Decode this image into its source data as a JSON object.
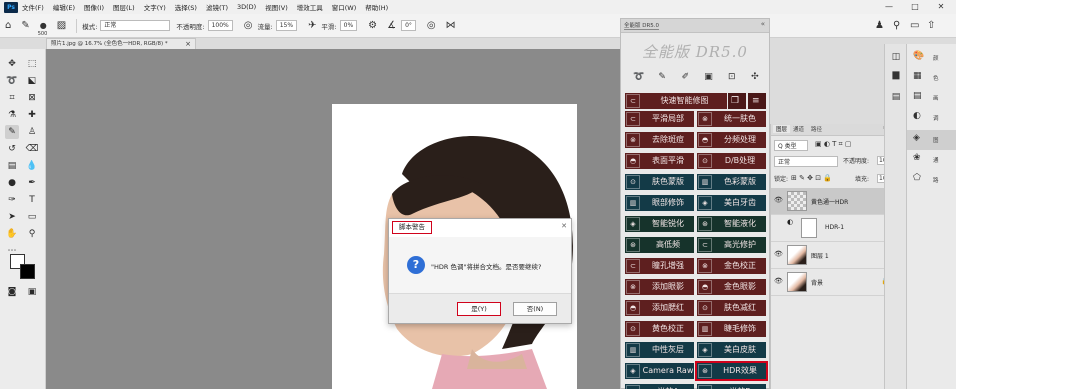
{
  "menubar": {
    "items": [
      "文件(F)",
      "编辑(E)",
      "图像(I)",
      "图层(L)",
      "文字(Y)",
      "选择(S)",
      "滤镜(T)",
      "3D(D)",
      "视图(V)",
      "增效工具",
      "窗口(W)",
      "帮助(H)"
    ],
    "minimize": "—",
    "maximize": "□",
    "close": "✕"
  },
  "optbar": {
    "brush_size": "500",
    "mode_label": "模式:",
    "mode_value": "正常",
    "opacity_label": "不透明度:",
    "opacity_value": "100%",
    "flow_label": "流量:",
    "flow_value": "15%",
    "smooth_label": "平滑:",
    "smooth_value": "0%",
    "angle_value": "0°"
  },
  "document": {
    "tab_title": "照片1.jpg @ 16.7% (全色色一HDR, RGB/8) *",
    "close": "×"
  },
  "dialog": {
    "title": "脚本警告",
    "message": "\"HDR 色调\"将拼合文档。是否要继续?",
    "yes": "是(Y)",
    "no": "否(N)",
    "icon": "?"
  },
  "plugin": {
    "header_label": "全能版 DR5.0",
    "collapse": "«",
    "menu": "≡",
    "brand": "全能版 DR5.0",
    "icon_names": [
      "lasso-icon",
      "brush-icon",
      "eraser-icon",
      "layer-icon",
      "crop-icon",
      "shortcut-icon"
    ],
    "top_button": "快速智能修图",
    "buttons": [
      {
        "left": "平滑局部",
        "right": "统一肤色",
        "color": "red"
      },
      {
        "left": "去除斑痘",
        "right": "分频处理",
        "color": "red"
      },
      {
        "left": "表面平滑",
        "right": "D/B处理",
        "color": "red"
      },
      {
        "left": "肤色蒙版",
        "right": "色彩蒙版",
        "color": "blue"
      },
      {
        "left": "眼部修饰",
        "right": "美白牙齿",
        "color": "blue"
      },
      {
        "left": "智能锐化",
        "right": "智能液化",
        "color": "green"
      },
      {
        "left": "高低频",
        "right": "高光修护",
        "color": "green"
      },
      {
        "left": "瞳孔增强",
        "right": "金色校正",
        "color": "red"
      },
      {
        "left": "添加眼影",
        "right": "金色眼影",
        "color": "red"
      },
      {
        "left": "添加腮红",
        "right": "肤色减红",
        "color": "red"
      },
      {
        "left": "黄色校正",
        "right": "睫毛修饰",
        "color": "red"
      },
      {
        "left": "中性灰层",
        "right": "美白皮肤",
        "color": "blue"
      },
      {
        "left": "Camera Raw",
        "right": "HDR效果",
        "color": "blue"
      },
      {
        "left": "光效A",
        "right": "光效B",
        "color": "blue"
      }
    ]
  },
  "layers": {
    "tabs": [
      "图层",
      "通道",
      "路径"
    ],
    "kind_label": "Q 类型",
    "blend_mode": "正常",
    "opacity_label": "不透明度:",
    "opacity_value": "100%",
    "lock_label": "锁定:",
    "fill_label": "填充:",
    "fill_value": "100%",
    "items": [
      {
        "name": "黄色通一HDR",
        "selected": true
      },
      {
        "name": "HDR-1",
        "selected": false
      },
      {
        "name": "图层 1",
        "selected": false
      },
      {
        "name": "背景",
        "selected": false
      }
    ]
  },
  "dock": {
    "items": [
      "颜",
      "色",
      "画",
      "调",
      "图",
      "通",
      "路"
    ]
  },
  "colors": {
    "accent_red": "#d0021b",
    "plugin_red": "#5e1f1f",
    "plugin_green": "#16332b",
    "plugin_blue": "#133a47",
    "canvas_gray": "#8a8a8a"
  }
}
